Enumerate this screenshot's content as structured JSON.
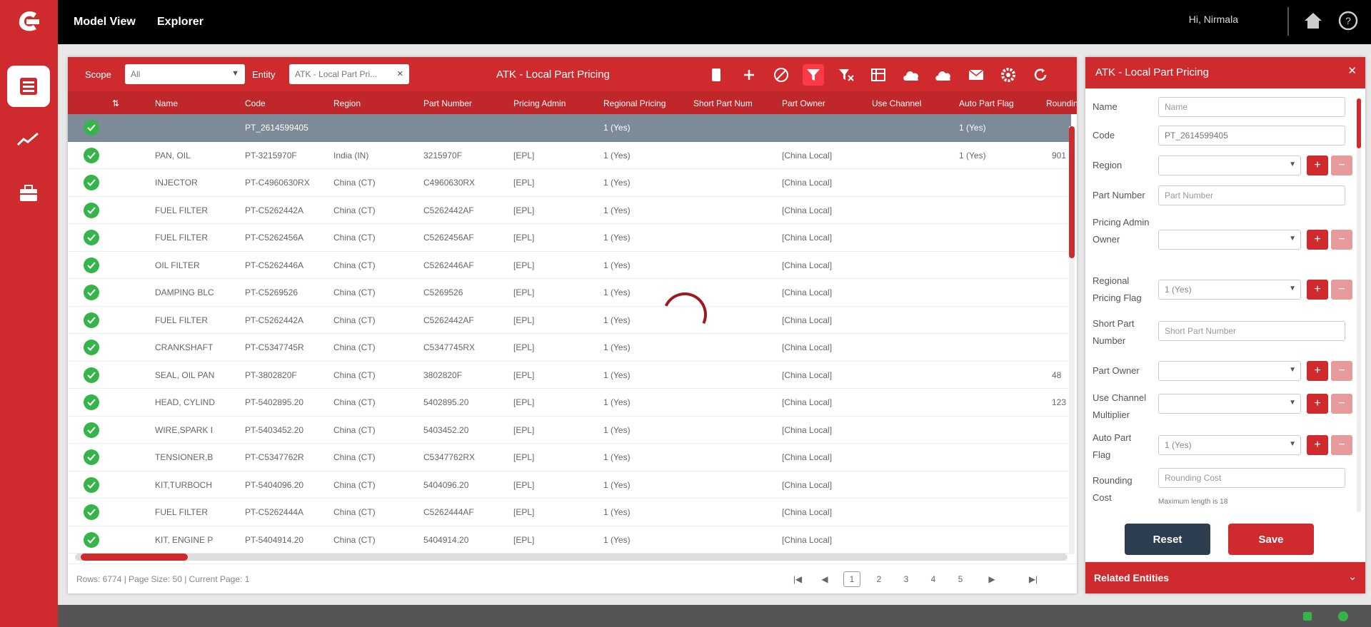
{
  "brand": {
    "accent": "#cf2b2e",
    "dark_header": "#c0272b",
    "selected_row": "#7d8a97",
    "ok": "#35b44a"
  },
  "topbar": {
    "nav": [
      "Model View",
      "Explorer"
    ],
    "greeting": "Hi, Nirmala"
  },
  "toolbar": {
    "scope_label": "Scope",
    "scope_value": "All",
    "entity_label": "Entity",
    "entity_value": "ATK - Local Part Pri...",
    "title": "ATK - Local Part Pricing"
  },
  "table": {
    "columns": [
      "Name",
      "Code",
      "Region",
      "Part Number",
      "Pricing Admin",
      "Regional Pricing",
      "Short Part Num",
      "Part Owner",
      "Use Channel",
      "Auto Part Flag",
      "Rounding"
    ],
    "selected_row": {
      "code": "PT_2614599405",
      "regional": "1 (Yes)",
      "auto": "1 (Yes)"
    },
    "rows": [
      {
        "name": "PAN, OIL",
        "code": "PT-3215970F",
        "region": "India (IN)",
        "part": "3215970F",
        "admin": "[EPL]",
        "regional": "1 (Yes)",
        "owner": "[China Local]",
        "auto": "1 (Yes)",
        "extra": "901"
      },
      {
        "name": "INJECTOR",
        "code": "PT-C4960630RX",
        "region": "China (CT)",
        "part": "C4960630RX",
        "admin": "[EPL]",
        "regional": "1 (Yes)",
        "owner": "[China Local]",
        "auto": "",
        "extra": ""
      },
      {
        "name": "FUEL FILTER",
        "code": "PT-C5262442A",
        "region": "China (CT)",
        "part": "C5262442AF",
        "admin": "[EPL]",
        "regional": "1 (Yes)",
        "owner": "[China Local]",
        "auto": "",
        "extra": ""
      },
      {
        "name": "FUEL FILTER",
        "code": "PT-C5262456A",
        "region": "China (CT)",
        "part": "C5262456AF",
        "admin": "[EPL]",
        "regional": "1 (Yes)",
        "owner": "[China Local]",
        "auto": "",
        "extra": ""
      },
      {
        "name": "OIL FILTER",
        "code": "PT-C5262446A",
        "region": "China (CT)",
        "part": "C5262446AF",
        "admin": "[EPL]",
        "regional": "1 (Yes)",
        "owner": "[China Local]",
        "auto": "",
        "extra": ""
      },
      {
        "name": "DAMPING BLC",
        "code": "PT-C5269526",
        "region": "China (CT)",
        "part": "C5269526",
        "admin": "[EPL]",
        "regional": "1 (Yes)",
        "owner": "[China Local]",
        "auto": "",
        "extra": ""
      },
      {
        "name": "FUEL FILTER",
        "code": "PT-C5262442A",
        "region": "China (CT)",
        "part": "C5262442AF",
        "admin": "[EPL]",
        "regional": "1 (Yes)",
        "owner": "[China Local]",
        "auto": "",
        "extra": ""
      },
      {
        "name": "CRANKSHAFT",
        "code": "PT-C5347745R",
        "region": "China (CT)",
        "part": "C5347745RX",
        "admin": "[EPL]",
        "regional": "1 (Yes)",
        "owner": "[China Local]",
        "auto": "",
        "extra": ""
      },
      {
        "name": "SEAL, OIL PAN",
        "code": "PT-3802820F",
        "region": "China (CT)",
        "part": "3802820F",
        "admin": "[EPL]",
        "regional": "1 (Yes)",
        "owner": "[China Local]",
        "auto": "",
        "extra": "48"
      },
      {
        "name": "HEAD, CYLIND",
        "code": "PT-5402895.20",
        "region": "China (CT)",
        "part": "5402895.20",
        "admin": "[EPL]",
        "regional": "1 (Yes)",
        "owner": "[China Local]",
        "auto": "",
        "extra": "123"
      },
      {
        "name": "WIRE,SPARK I",
        "code": "PT-5403452.20",
        "region": "China (CT)",
        "part": "5403452.20",
        "admin": "[EPL]",
        "regional": "1 (Yes)",
        "owner": "[China Local]",
        "auto": "",
        "extra": ""
      },
      {
        "name": "TENSIONER,B",
        "code": "PT-C5347762R",
        "region": "China (CT)",
        "part": "C5347762RX",
        "admin": "[EPL]",
        "regional": "1 (Yes)",
        "owner": "[China Local]",
        "auto": "",
        "extra": ""
      },
      {
        "name": "KIT,TURBOCH",
        "code": "PT-5404096.20",
        "region": "China (CT)",
        "part": "5404096.20",
        "admin": "[EPL]",
        "regional": "1 (Yes)",
        "owner": "[China Local]",
        "auto": "",
        "extra": ""
      },
      {
        "name": "FUEL FILTER",
        "code": "PT-C5262444A",
        "region": "China (CT)",
        "part": "C5262444AF",
        "admin": "[EPL]",
        "regional": "1 (Yes)",
        "owner": "[China Local]",
        "auto": "",
        "extra": ""
      },
      {
        "name": "KIT, ENGINE P",
        "code": "PT-5404914.20",
        "region": "China (CT)",
        "part": "5404914.20",
        "admin": "[EPL]",
        "regional": "1 (Yes)",
        "owner": "[China Local]",
        "auto": "",
        "extra": ""
      }
    ]
  },
  "footer": {
    "info": "Rows: 6774 | Page Size: 50 | Current Page: 1",
    "pages": [
      "|◀",
      "◀",
      "1",
      "2",
      "3",
      "4",
      "5",
      "▶",
      "▶|"
    ]
  },
  "form": {
    "title": "ATK - Local Part Pricing",
    "name_label": "Name",
    "name_placeholder": "Name",
    "code_label": "Code",
    "code_value": "PT_2614599405",
    "region_label": "Region",
    "part_label": "Part Number",
    "part_placeholder": "Part Number",
    "pricing_label": "Pricing Admin Owner",
    "regional_label": "Regional Pricing Flag",
    "regional_value": "1 (Yes)",
    "short_label": "Short Part Number",
    "short_placeholder": "Short Part Number",
    "owner_label": "Part Owner",
    "channel_label": "Use Channel Multiplier",
    "auto_label": "Auto Part Flag",
    "auto_value": "1 (Yes)",
    "rounding_label": "Rounding Cost",
    "rounding_placeholder": "Rounding Cost",
    "rounding_hint": "Maximum length is 18",
    "reset": "Reset",
    "save": "Save",
    "related": "Related Entities"
  }
}
